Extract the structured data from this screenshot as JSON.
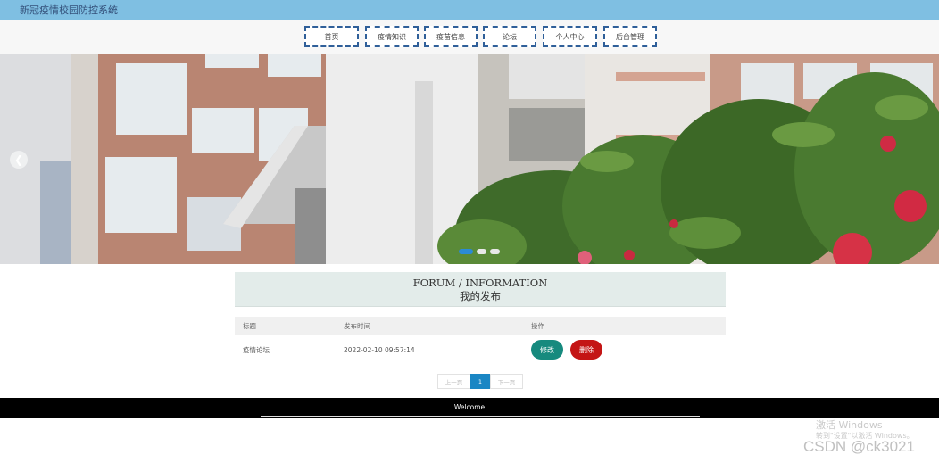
{
  "app": {
    "title": "新冠疫情校园防控系统"
  },
  "nav": {
    "items": [
      {
        "label": "首页"
      },
      {
        "label": "疫情知识"
      },
      {
        "label": "疫苗信息"
      },
      {
        "label": "论坛"
      },
      {
        "label": "个人中心"
      },
      {
        "label": "后台管理"
      }
    ]
  },
  "carousel": {
    "prev_icon": "chevron-left-icon",
    "slides": 3,
    "active_slide": 1
  },
  "section": {
    "title_en": "FORUM / INFORMATION",
    "title_cn": "我的发布"
  },
  "table": {
    "headers": [
      "标题",
      "发布时间",
      "操作"
    ],
    "rows": [
      {
        "title": "疫情论坛",
        "time": "2022-02-10 09:57:14",
        "edit_label": "修改",
        "delete_label": "删除"
      }
    ]
  },
  "pagination": {
    "prev_label": "上一页",
    "current_page": "1",
    "next_label": "下一页"
  },
  "footer": {
    "text": "Welcome"
  },
  "watermark": {
    "line1": "激活 Windows",
    "line2": "转到\"设置\"以激活 Windows。",
    "credit": "CSDN @ck3021"
  },
  "colors": {
    "topbar": "#7fbfe2",
    "edit": "#168a7e",
    "delete": "#c41515",
    "page_active": "#1a86c4"
  }
}
